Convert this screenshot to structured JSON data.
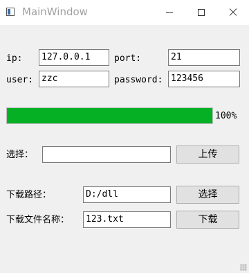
{
  "window": {
    "title": "MainWindow"
  },
  "connection": {
    "ip_label": "ip:",
    "ip_value": "127.0.0.1",
    "port_label": "port:",
    "port_value": "21",
    "user_label": "user:",
    "user_value": "zzc",
    "password_label": "password:",
    "password_value": "123456"
  },
  "progress": {
    "value": 100,
    "text": "100%",
    "color": "#06b025"
  },
  "upload": {
    "label": "选择：",
    "value": "",
    "button_label": "上传"
  },
  "download": {
    "path_label": "下载路径：",
    "path_value": "D:/dll",
    "choose_button_label": "选择",
    "filename_label": "下载文件名称：",
    "filename_value": "123.txt",
    "download_button_label": "下载"
  }
}
